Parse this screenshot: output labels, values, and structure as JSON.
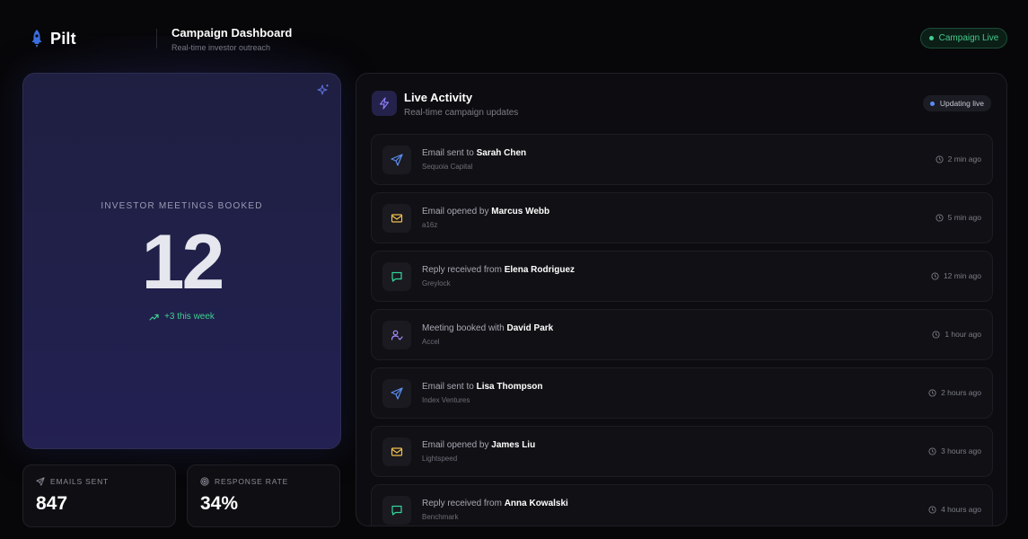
{
  "app": {
    "name": "Pilt"
  },
  "header": {
    "title": "Campaign Dashboard",
    "subtitle": "Real-time investor outreach",
    "status_label": "Campaign Live"
  },
  "meetings": {
    "label": "INVESTOR MEETINGS BOOKED",
    "value": "12",
    "delta": "+3 this week"
  },
  "stats": [
    {
      "label": "EMAILS SENT",
      "value": "847",
      "icon": "send-icon"
    },
    {
      "label": "RESPONSE RATE",
      "value": "34%",
      "icon": "target-icon"
    }
  ],
  "activity": {
    "title": "Live Activity",
    "subtitle": "Real-time campaign updates",
    "status_label": "Updating live",
    "items": [
      {
        "type": "sent",
        "action": "Email sent to",
        "name": "Sarah Chen",
        "org": "Sequoia Capital",
        "time": "2 min ago"
      },
      {
        "type": "opened",
        "action": "Email opened by",
        "name": "Marcus Webb",
        "org": "a16z",
        "time": "5 min ago"
      },
      {
        "type": "reply",
        "action": "Reply received from",
        "name": "Elena Rodriguez",
        "org": "Greylock",
        "time": "12 min ago"
      },
      {
        "type": "meeting",
        "action": "Meeting booked with",
        "name": "David Park",
        "org": "Accel",
        "time": "1 hour ago"
      },
      {
        "type": "sent",
        "action": "Email sent to",
        "name": "Lisa Thompson",
        "org": "Index Ventures",
        "time": "2 hours ago"
      },
      {
        "type": "opened",
        "action": "Email opened by",
        "name": "James Liu",
        "org": "Lightspeed",
        "time": "3 hours ago"
      },
      {
        "type": "reply",
        "action": "Reply received from",
        "name": "Anna Kowalski",
        "org": "Benchmark",
        "time": "4 hours ago"
      }
    ]
  },
  "colors": {
    "accent_green": "#3fcf8e",
    "accent_blue": "#5b8def",
    "accent_yellow": "#f2c14e",
    "accent_teal": "#34d399",
    "accent_purple": "#a78bfa"
  }
}
